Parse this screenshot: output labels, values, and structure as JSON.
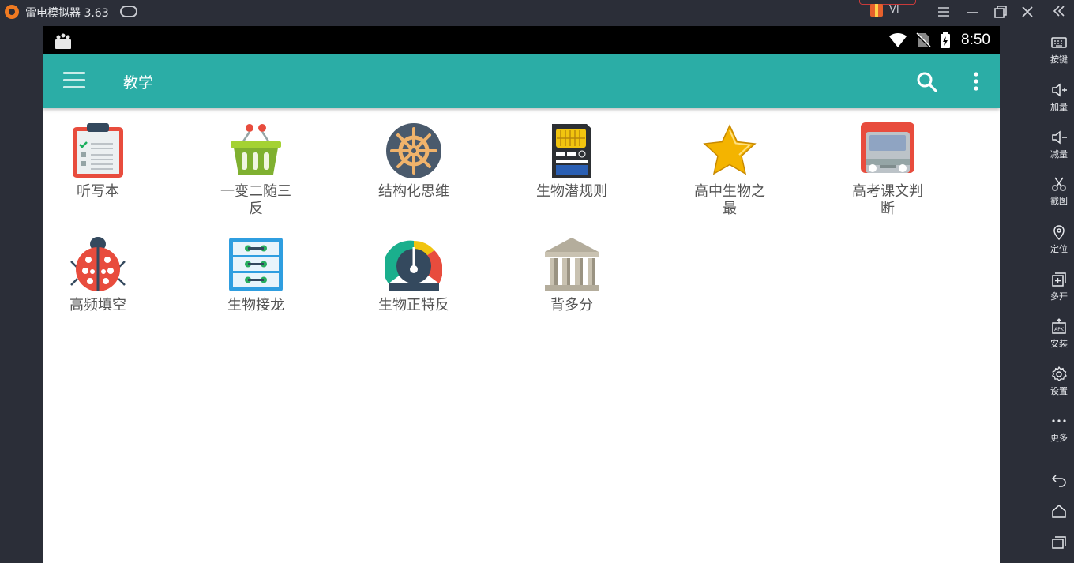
{
  "emulator": {
    "title": "雷电模拟器 3.63",
    "vip": "VI"
  },
  "sidebar": {
    "items": [
      {
        "label": "按键",
        "icon": "keyboard-icon"
      },
      {
        "label": "加量",
        "icon": "volume-up-icon"
      },
      {
        "label": "减量",
        "icon": "volume-down-icon"
      },
      {
        "label": "截图",
        "icon": "scissors-icon"
      },
      {
        "label": "定位",
        "icon": "location-pin-icon"
      },
      {
        "label": "多开",
        "icon": "multi-open-icon"
      },
      {
        "label": "安装",
        "icon": "apk-install-icon"
      },
      {
        "label": "设置",
        "icon": "gear-icon"
      },
      {
        "label": "更多",
        "icon": "more-dots-icon"
      }
    ],
    "nav": [
      "back-icon",
      "home-icon",
      "recents-icon"
    ]
  },
  "statusbar": {
    "time": "8:50"
  },
  "appbar": {
    "title": "教学"
  },
  "apps": [
    {
      "label": "听写本",
      "icon": "clipboard-checklist-icon"
    },
    {
      "label": "一变二随三反",
      "icon": "basket-icon"
    },
    {
      "label": "结构化思维",
      "icon": "ship-wheel-icon"
    },
    {
      "label": "生物潜规则",
      "icon": "memory-card-icon"
    },
    {
      "label": "高中生物之最",
      "icon": "star-icon"
    },
    {
      "label": "高考课文判断",
      "icon": "bus-icon"
    },
    {
      "label": "高频填空",
      "icon": "ladybug-icon"
    },
    {
      "label": "生物接龙",
      "icon": "file-cabinet-icon"
    },
    {
      "label": "生物正特反",
      "icon": "gauge-icon"
    },
    {
      "label": "背多分",
      "icon": "bank-building-icon"
    }
  ],
  "colors": {
    "appbar": "#2bada6",
    "emulator_chrome": "#2b2e38"
  }
}
